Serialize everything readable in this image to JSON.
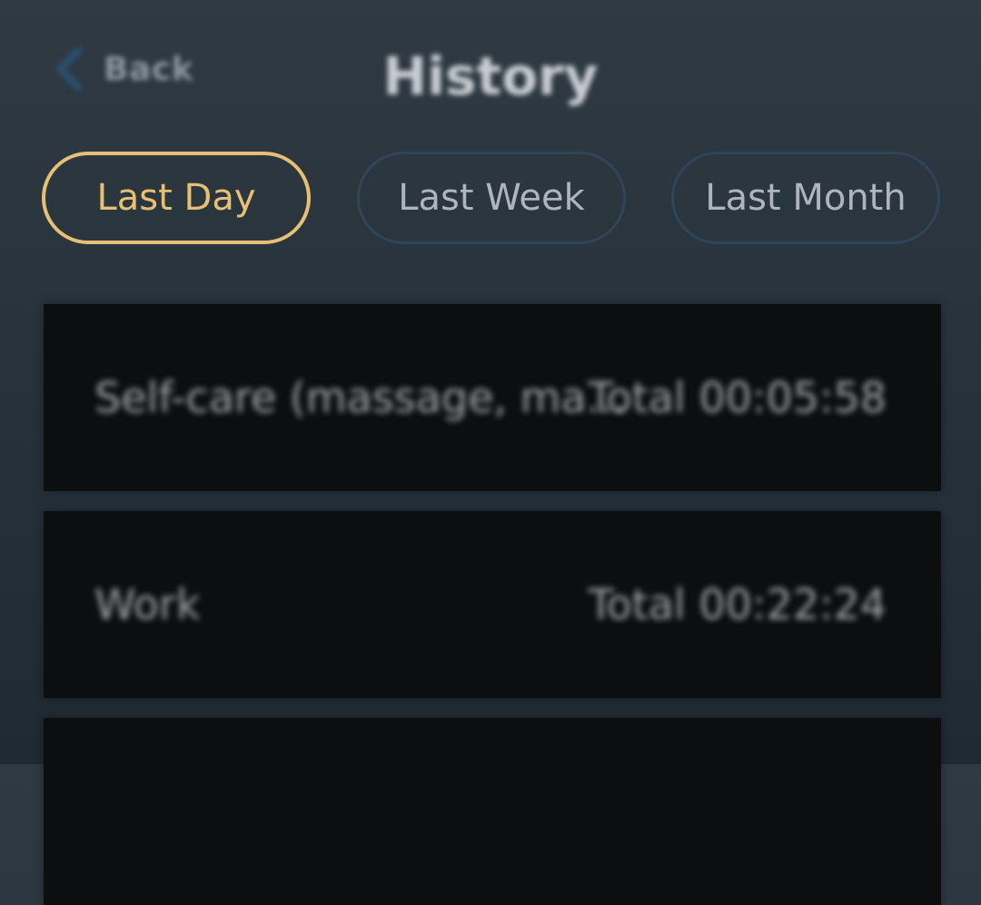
{
  "header": {
    "back_label": "Back",
    "title": "History"
  },
  "filters": {
    "selected": "Last Day",
    "options": [
      "Last Day",
      "Last Week",
      "Last Month"
    ]
  },
  "entries": [
    {
      "name": "Self-care (massage, ma...",
      "total": "Total 00:05:58"
    },
    {
      "name": "Work",
      "total": "Total 00:22:24"
    }
  ],
  "colors": {
    "accent": "#e6c074",
    "inactive_border": "#2f4558",
    "card_bg": "#0d0e0f",
    "back_chevron": "#2c4f6c"
  },
  "icons": {
    "back": "chevron-left-icon"
  }
}
